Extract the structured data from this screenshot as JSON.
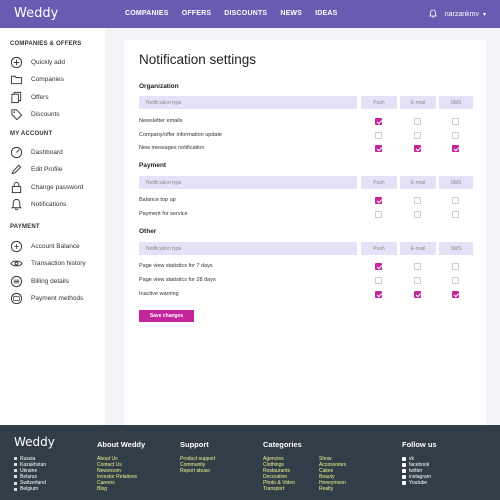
{
  "header": {
    "brand": "Weddy",
    "nav": [
      "COMPANIES",
      "OFFERS",
      "DISCOUNTS",
      "NEWS",
      "IDEAS"
    ],
    "username": "narzankmv"
  },
  "sidebar": {
    "sections": [
      {
        "title": "COMPANIES & OFFERS",
        "items": [
          {
            "label": "Quickly add",
            "icon": "plus-circle-icon"
          },
          {
            "label": "Companies",
            "icon": "folder-icon"
          },
          {
            "label": "Offers",
            "icon": "copy-icon"
          },
          {
            "label": "Discounts",
            "icon": "tag-icon"
          }
        ]
      },
      {
        "title": "MY ACCOUNT",
        "items": [
          {
            "label": "Dashboard",
            "icon": "gauge-icon"
          },
          {
            "label": "Edit Profile",
            "icon": "pencil-icon"
          },
          {
            "label": "Change password",
            "icon": "lock-icon"
          },
          {
            "label": "Notifications",
            "icon": "bell-icon"
          }
        ]
      },
      {
        "title": "PAYMENT",
        "items": [
          {
            "label": "Account Balance",
            "icon": "wallet-icon"
          },
          {
            "label": "Transaction history",
            "icon": "eye-icon"
          },
          {
            "label": "Billing details",
            "icon": "billing-icon"
          },
          {
            "label": "Payment methods",
            "icon": "card-icon"
          }
        ]
      }
    ]
  },
  "main": {
    "title": "Notification settings",
    "header_labels": {
      "type": "Notification type",
      "push": "Push",
      "email": "E-mail",
      "sms": "SMS"
    },
    "groups": [
      {
        "name": "Organization",
        "rows": [
          {
            "label": "Newsletter emails",
            "push": true,
            "email": false,
            "sms": false
          },
          {
            "label": "Company/offer information update",
            "push": false,
            "email": false,
            "sms": false
          },
          {
            "label": "New messages notification",
            "push": true,
            "email": true,
            "sms": true
          }
        ]
      },
      {
        "name": "Payment",
        "rows": [
          {
            "label": "Balance top up",
            "push": true,
            "email": false,
            "sms": false
          },
          {
            "label": "Payment for service",
            "push": false,
            "email": false,
            "sms": false
          }
        ]
      },
      {
        "name": "Other",
        "rows": [
          {
            "label": "Page view statistics for 7 days",
            "push": true,
            "email": false,
            "sms": false
          },
          {
            "label": "Page view statistics for 28 days",
            "push": false,
            "email": false,
            "sms": false
          },
          {
            "label": "Inactive warning",
            "push": true,
            "email": true,
            "sms": true
          }
        ]
      }
    ],
    "save_label": "Save changes"
  },
  "footer": {
    "brand": "Weddy",
    "countries": [
      "Russia",
      "Kazakhstan",
      "Ukraine",
      "Belarus",
      "Switzerland",
      "Belgium"
    ],
    "about": {
      "title": "About Weddy",
      "links": [
        "About Us",
        "Contact Us",
        "Newsroom",
        "Investor Relations",
        "Careers",
        "Blog"
      ]
    },
    "support": {
      "title": "Support",
      "links": [
        "Product support",
        "Community",
        "Report abuse"
      ]
    },
    "categories": {
      "title": "Categories",
      "col1": [
        "Agencies",
        "Clothings",
        "Restaurants",
        "Decoration",
        "Photo & Video",
        "Transport"
      ],
      "col2": [
        "Show",
        "Accessories",
        "Cakes",
        "Beauty",
        "Honeymoon",
        "Realty"
      ]
    },
    "follow": {
      "title": "Follow us",
      "links": [
        "vk",
        "facebook",
        "twitter",
        "instagram",
        "Youtube"
      ]
    },
    "colors": {
      "accent": "#c3259b",
      "header": "#6b5ab1",
      "footer": "#313e47",
      "link": "#f2f28e"
    }
  }
}
